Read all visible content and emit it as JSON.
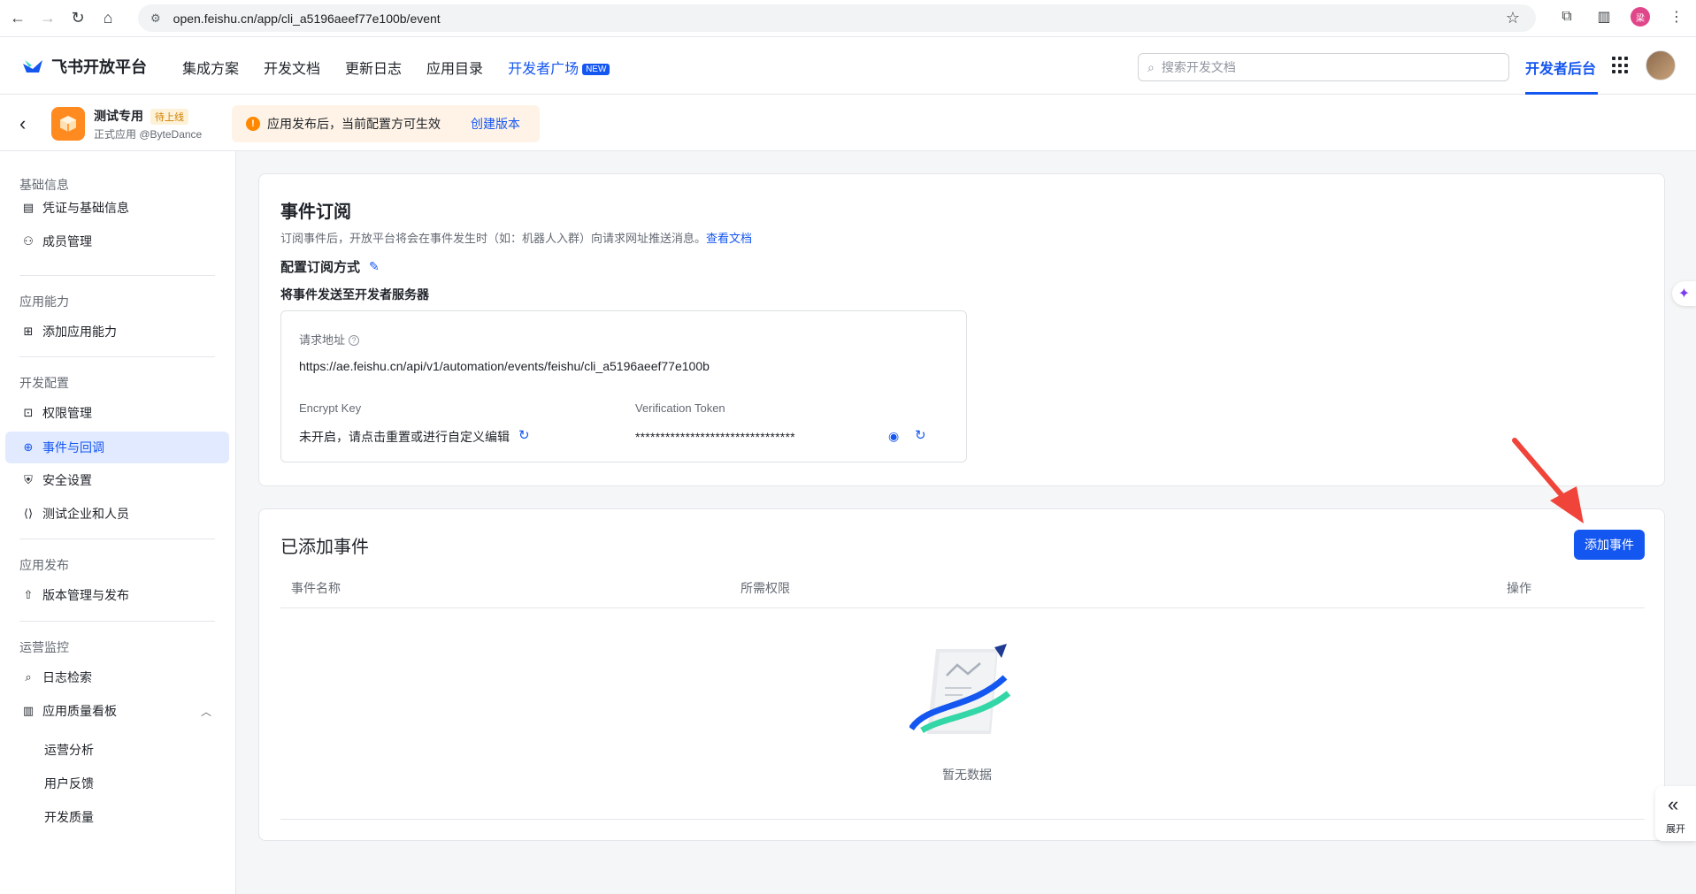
{
  "browser": {
    "url": "open.feishu.cn/app/cli_a5196aeef77e100b/event",
    "profile_initial": "梁"
  },
  "header": {
    "brand": "飞书开放平台",
    "nav": [
      "集成方案",
      "开发文档",
      "更新日志",
      "应用目录"
    ],
    "nav_highlight": "开发者广场",
    "new_badge": "NEW",
    "search_placeholder": "搜索开发文档",
    "dev_console": "开发者后台"
  },
  "app": {
    "name": "测试专用",
    "status": "待上线",
    "subtitle": "正式应用 @ByteDance",
    "notice": "应用发布后，当前配置方可生效",
    "notice_link": "创建版本"
  },
  "sidebar": {
    "groups": [
      {
        "title": "基础信息",
        "items": [
          "凭证与基础信息",
          "成员管理"
        ]
      },
      {
        "title": "应用能力",
        "items": [
          "添加应用能力"
        ]
      },
      {
        "title": "开发配置",
        "items": [
          "权限管理",
          "事件与回调",
          "安全设置",
          "测试企业和人员"
        ]
      },
      {
        "title": "应用发布",
        "items": [
          "版本管理与发布"
        ]
      },
      {
        "title": "运营监控",
        "items": [
          "日志检索",
          "应用质量看板"
        ]
      }
    ],
    "subitems": [
      "运营分析",
      "用户反馈",
      "开发质量"
    ],
    "active": "事件与回调"
  },
  "event_sub": {
    "title": "事件订阅",
    "desc": "订阅事件后，开放平台将会在事件发生时（如：机器人入群）向请求网址推送消息。",
    "desc_link": "查看文档",
    "config_title": "配置订阅方式",
    "method": "将事件发送至开发者服务器",
    "request_url_label": "请求地址",
    "request_url": "https://ae.feishu.cn/api/v1/automation/events/feishu/cli_a5196aeef77e100b",
    "encrypt_label": "Encrypt Key",
    "encrypt_value": "未开启，请点击重置或进行自定义编辑",
    "token_label": "Verification Token",
    "token_value": "********************************"
  },
  "added_events": {
    "title": "已添加事件",
    "add_button": "添加事件",
    "columns": [
      "事件名称",
      "所需权限",
      "操作"
    ],
    "empty_text": "暂无数据"
  },
  "expand": {
    "label": "展开"
  },
  "colors": {
    "primary": "#1456f0",
    "warning": "#ff8800",
    "annotation": "#f0443a"
  }
}
